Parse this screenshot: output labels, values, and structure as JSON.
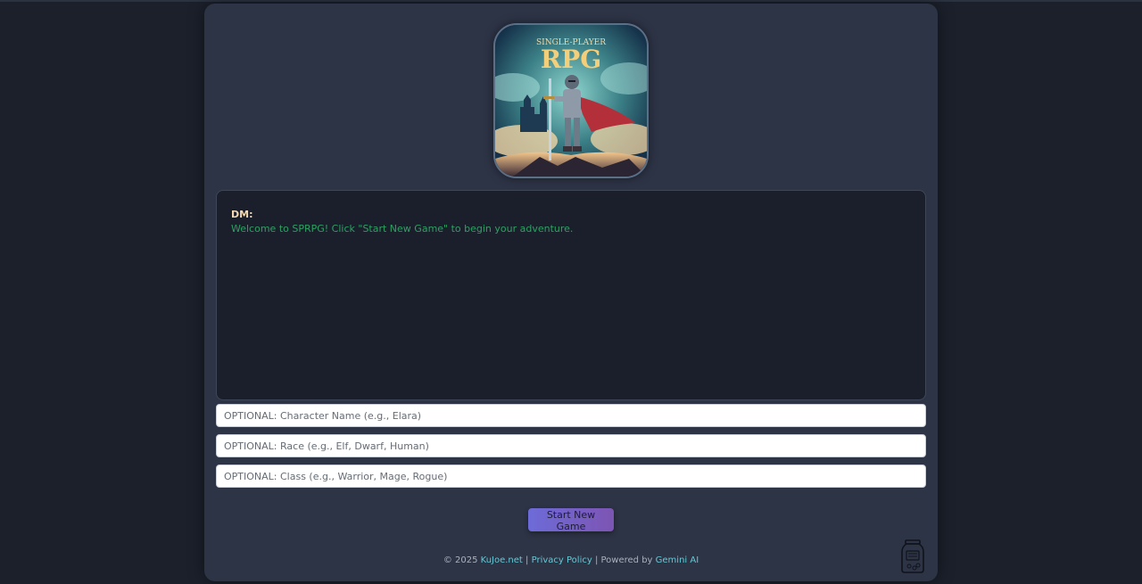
{
  "logo": {
    "top_text": "SINGLE-PLAYER",
    "main_text": "RPG"
  },
  "chat": {
    "speaker": "DM:",
    "message": "Welcome to SPRPG! Click \"Start New Game\" to begin your adventure."
  },
  "form": {
    "name_placeholder": "OPTIONAL: Character Name (e.g., Elara)",
    "race_placeholder": "OPTIONAL: Race (e.g., Elf, Dwarf, Human)",
    "class_placeholder": "OPTIONAL: Class (e.g., Warrior, Mage, Rogue)",
    "start_label": "Start New Game"
  },
  "footer": {
    "copyright": "© 2025",
    "site_link": "KuJoe.net",
    "sep1": "|",
    "privacy_link": "Privacy Policy",
    "sep2": "| Powered by",
    "ai_link": "Gemini AI"
  },
  "colors": {
    "page_bg": "#1b202b",
    "panel_bg": "#2d3446",
    "chat_bg": "#1b1f2b",
    "speaker": "#f3d9b4",
    "message": "#2ea063",
    "link": "#66c7d4",
    "button_start": "#6d6bd8",
    "button_end": "#7d55b3"
  },
  "icons": {
    "logo": "knight-logo-icon",
    "jar": "tip-jar-icon"
  }
}
